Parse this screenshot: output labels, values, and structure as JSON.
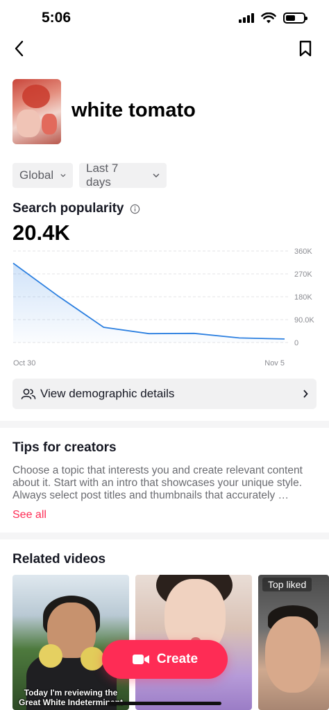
{
  "status_bar": {
    "time": "5:06",
    "battery_level": 0.55
  },
  "nav": {
    "back_icon": "chevron-left-icon",
    "bookmark_icon": "bookmark-icon"
  },
  "topic": {
    "title": "white tomato"
  },
  "filters": {
    "region": "Global",
    "period": "Last 7 days"
  },
  "popularity": {
    "label": "Search popularity",
    "value": "20.4K",
    "info_icon": "info-icon"
  },
  "chart_data": {
    "type": "area",
    "x_labels": [
      "Oct 30",
      "Nov 5"
    ],
    "x": [
      "Oct 30",
      "Oct 31",
      "Nov 1",
      "Nov 2",
      "Nov 3",
      "Nov 4",
      "Nov 5"
    ],
    "values": [
      312000,
      182000,
      60000,
      35000,
      36000,
      18000,
      14000
    ],
    "y_ticks": [
      "360K",
      "270K",
      "180K",
      "90.0K",
      "0"
    ],
    "ylim": [
      0,
      360000
    ],
    "grid": true,
    "color": "#2b7fe0"
  },
  "demographic": {
    "label": "View demographic details",
    "icon": "people-icon"
  },
  "tips": {
    "title": "Tips for creators",
    "text": "Choose a topic that interests you and create relevant content about it. Start with an intro that showcases your unique style. Always select post titles and thumbnails that accurately …",
    "see_all": "See all"
  },
  "related": {
    "title": "Related videos",
    "videos": [
      {
        "caption": "Today I'm reviewing the Great White Indeterminant"
      },
      {
        "caption": ""
      },
      {
        "badge": "Top liked"
      }
    ]
  },
  "create_button": {
    "label": "Create",
    "icon": "video-camera-icon"
  },
  "colors": {
    "accent": "#fe2c55",
    "chart_line": "#2b7fe0"
  }
}
